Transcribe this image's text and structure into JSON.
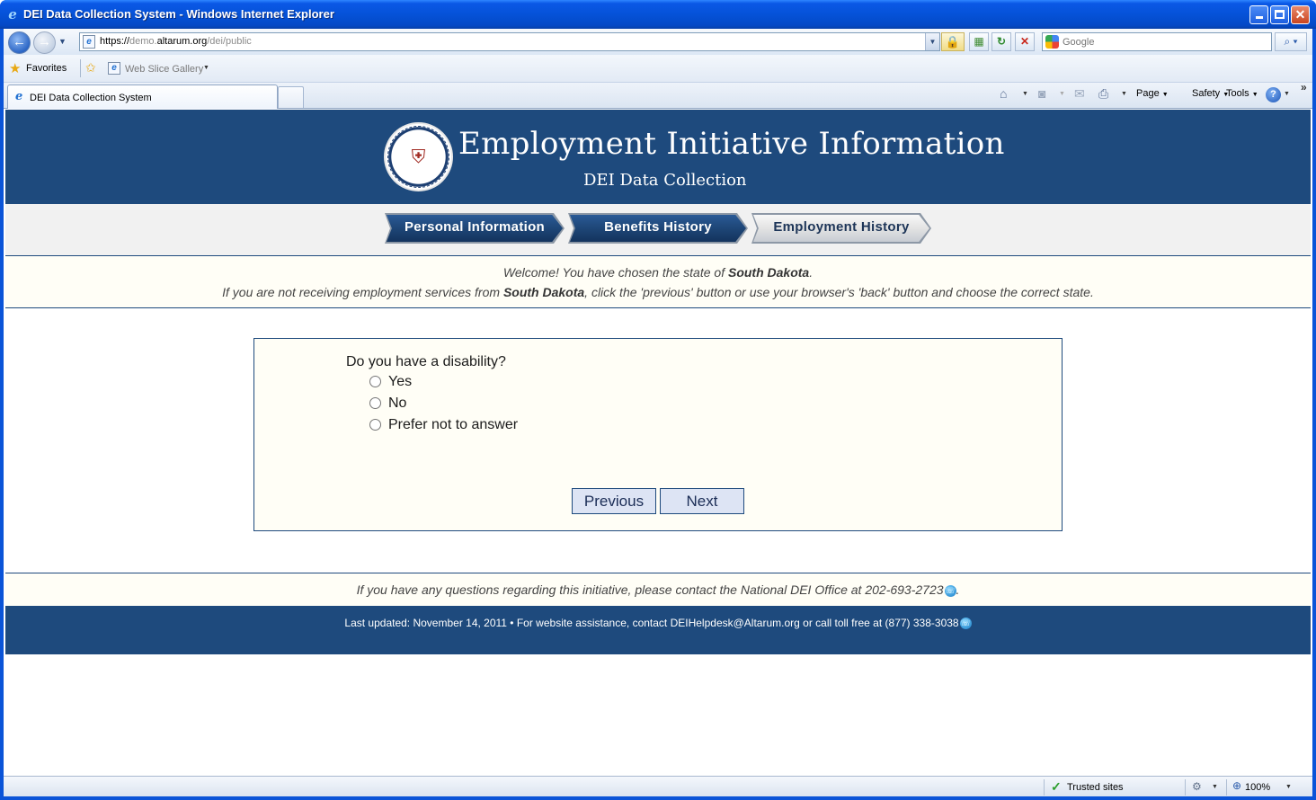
{
  "window": {
    "title": "DEI Data Collection System - Windows Internet Explorer"
  },
  "browser": {
    "url_prefix": "https://",
    "url_sub": "demo.",
    "url_domain": "altarum.org",
    "url_path": "/dei/public",
    "search_placeholder": "Google",
    "favorites_label": "Favorites",
    "web_slice_label": "Web Slice Gallery",
    "tab_title": "DEI Data Collection System",
    "commands": {
      "page": "Page",
      "safety": "Safety",
      "tools": "Tools"
    }
  },
  "page": {
    "banner": {
      "title": "Employment Initiative Information",
      "subtitle": "DEI Data Collection"
    },
    "steps": [
      {
        "label": "Personal Information",
        "state": "completed"
      },
      {
        "label": "Benefits History",
        "state": "completed"
      },
      {
        "label": "Employment History",
        "state": "current"
      }
    ],
    "welcome": {
      "line1_prefix": "Welcome! You have chosen the state of ",
      "state": "South Dakota",
      "line1_suffix": ".",
      "line2_prefix": "If you are not receiving employment services from ",
      "line2_state": "South Dakota",
      "line2_suffix": ", click the 'previous' button or use your browser's 'back' button and choose the correct state."
    },
    "form": {
      "question": "Do you have a disability?",
      "options": [
        {
          "label": "Yes",
          "selected": false
        },
        {
          "label": "No",
          "selected": false
        },
        {
          "label": "Prefer not to answer",
          "selected": false
        }
      ],
      "previous_label": "Previous",
      "next_label": "Next"
    },
    "contact_text": "If you have any questions regarding this initiative, please contact the National DEI Office at 202-693-2723",
    "contact_suffix": ".",
    "footer_text": "Last updated: November 14, 2011 • For website assistance, contact DEIHelpdesk@Altarum.org or call toll free at (877) 338-3038"
  },
  "statusbar": {
    "zone": "Trusted sites",
    "zoom": "100%"
  },
  "colors": {
    "banner_bg": "#1e4a7d",
    "panel_bg": "#fffef6",
    "button_bg": "#dde4f4",
    "titlebar": "#0552d8"
  }
}
